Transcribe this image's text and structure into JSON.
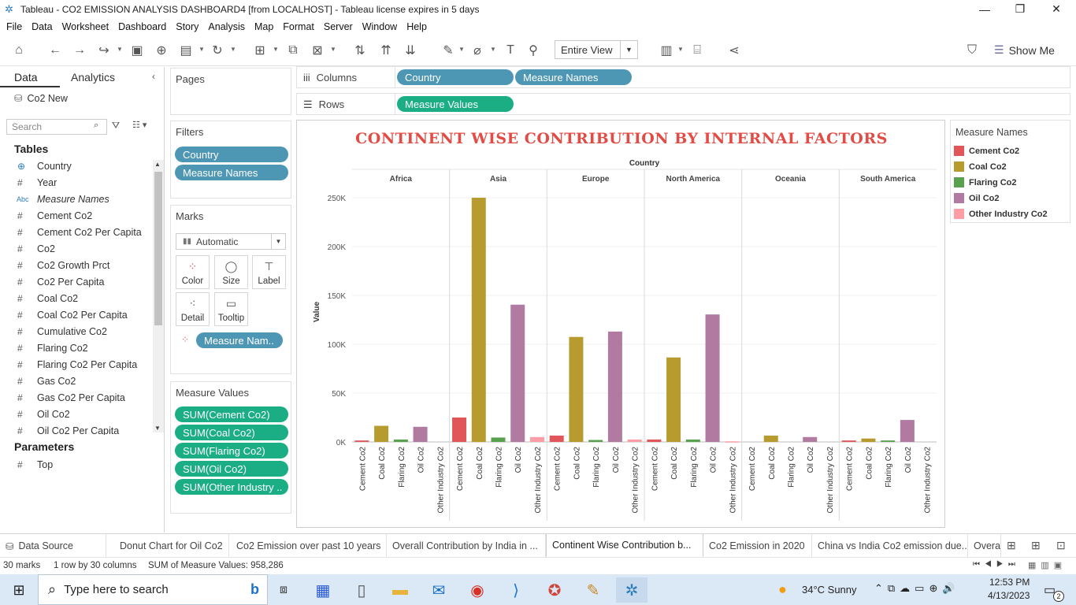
{
  "window": {
    "title": "Tableau - CO2 EMISSION ANALYSIS DASHBOARD4 [from LOCALHOST] - Tableau license expires in 5 days"
  },
  "menu": [
    "File",
    "Data",
    "Worksheet",
    "Dashboard",
    "Story",
    "Analysis",
    "Map",
    "Format",
    "Server",
    "Window",
    "Help"
  ],
  "toolbar": {
    "fit_value": "Entire View",
    "show_me_label": "Show Me"
  },
  "data_pane": {
    "tab_data": "Data",
    "tab_analytics": "Analytics",
    "datasource": "Co2 New",
    "search_placeholder": "Search",
    "tables_heading": "Tables",
    "fields": [
      {
        "icon": "globe",
        "name": "Country"
      },
      {
        "icon": "#",
        "name": "Year"
      },
      {
        "icon": "Abc",
        "name": "Measure Names"
      },
      {
        "icon": "#",
        "name": "Cement Co2"
      },
      {
        "icon": "#",
        "name": "Cement Co2 Per Capita"
      },
      {
        "icon": "#",
        "name": "Co2"
      },
      {
        "icon": "#",
        "name": "Co2 Growth Prct"
      },
      {
        "icon": "#",
        "name": "Co2 Per Capita"
      },
      {
        "icon": "#",
        "name": "Coal Co2"
      },
      {
        "icon": "#",
        "name": "Coal Co2 Per Capita"
      },
      {
        "icon": "#",
        "name": "Cumulative Co2"
      },
      {
        "icon": "#",
        "name": "Flaring Co2"
      },
      {
        "icon": "#",
        "name": "Flaring Co2 Per Capita"
      },
      {
        "icon": "#",
        "name": "Gas Co2"
      },
      {
        "icon": "#",
        "name": "Gas Co2 Per Capita"
      },
      {
        "icon": "#",
        "name": "Oil Co2"
      },
      {
        "icon": "#",
        "name": "Oil Co2 Per Capita"
      }
    ],
    "parameters_heading": "Parameters",
    "parameters": [
      {
        "icon": "#",
        "name": "Top"
      }
    ]
  },
  "cards": {
    "pages": "Pages",
    "filters": "Filters",
    "filter_pills": [
      "Country",
      "Measure Names"
    ],
    "marks": "Marks",
    "mark_type": "Automatic",
    "mark_buttons": [
      "Color",
      "Size",
      "Label",
      "Detail",
      "Tooltip"
    ],
    "color_pill": "Measure Nam..",
    "measure_values": "Measure Values",
    "mv_pills": [
      "SUM(Cement Co2)",
      "SUM(Coal Co2)",
      "SUM(Flaring Co2)",
      "SUM(Oil Co2)",
      "SUM(Other Industry .."
    ]
  },
  "shelves": {
    "columns_label": "Columns",
    "rows_label": "Rows",
    "columns_pills": [
      "Country",
      "Measure Names"
    ],
    "rows_pills": [
      "Measure Values"
    ]
  },
  "legend": {
    "title": "Measure Names",
    "items": [
      {
        "name": "Cement Co2",
        "color": "#e15759"
      },
      {
        "name": "Coal Co2",
        "color": "#b89b2e"
      },
      {
        "name": "Flaring Co2",
        "color": "#59a14f"
      },
      {
        "name": "Oil Co2",
        "color": "#b07aa1"
      },
      {
        "name": "Other Industry Co2",
        "color": "#ff9da7"
      }
    ]
  },
  "chart_data": {
    "type": "bar",
    "title": "CONTINENT WISE CONTRIBUTION BY INTERNAL FACTORS",
    "panel_header": "Country",
    "ylabel": "Value",
    "ylim": [
      0,
      250000
    ],
    "yticks": [
      {
        "value": 0,
        "label": "0K"
      },
      {
        "value": 50000,
        "label": "50K"
      },
      {
        "value": 100000,
        "label": "100K"
      },
      {
        "value": 150000,
        "label": "150K"
      },
      {
        "value": 200000,
        "label": "200K"
      },
      {
        "value": 250000,
        "label": "250K"
      }
    ],
    "grid": true,
    "countries": [
      "Africa",
      "Asia",
      "Europe",
      "North America",
      "Oceania",
      "South America"
    ],
    "measures": [
      "Cement Co2",
      "Coal Co2",
      "Flaring Co2",
      "Oil Co2",
      "Other Industry Co2"
    ],
    "colors": [
      "#e15759",
      "#b89b2e",
      "#59a14f",
      "#b07aa1",
      "#ff9da7"
    ],
    "values": [
      [
        1500,
        16500,
        2500,
        15500,
        0
      ],
      [
        25000,
        250000,
        4500,
        140500,
        5000
      ],
      [
        6500,
        107500,
        2000,
        113000,
        2500
      ],
      [
        2500,
        86500,
        2500,
        130500,
        600
      ],
      [
        0,
        6500,
        0,
        5000,
        0
      ],
      [
        1500,
        3500,
        1500,
        22500,
        0
      ]
    ]
  },
  "sheet_tabs": {
    "datasource": "Data Source",
    "tabs": [
      "Donut Chart for Oil Co2",
      "Co2 Emission over past 10 years",
      "Overall Contribution by India in ...",
      "Continent Wise Contribution b...",
      "Co2 Emission in 2020",
      "China vs India Co2 emission due...",
      "Overa"
    ]
  },
  "status": {
    "marks": "30 marks",
    "rows_cols": "1 row by 30 columns",
    "sum": "SUM of Measure Values: 958,286"
  },
  "taskbar": {
    "search_placeholder": "Type here to search",
    "weather": "34°C  Sunny",
    "time": "12:53 PM",
    "date": "4/13/2023",
    "notif_count": "2"
  }
}
